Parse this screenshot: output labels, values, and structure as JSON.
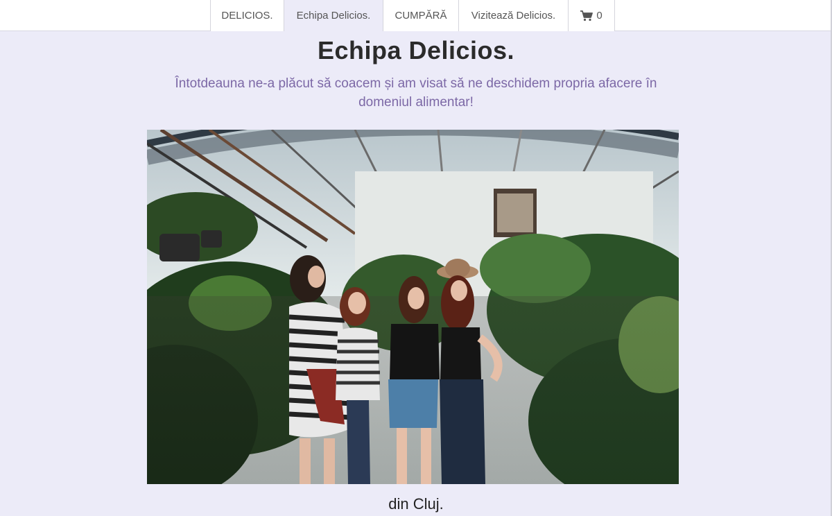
{
  "nav": {
    "items": [
      {
        "label": "DELICIOS."
      },
      {
        "label": "Echipa Delicios."
      },
      {
        "label": "CUMPĂRĂ"
      },
      {
        "label": "Vizitează Delicios."
      }
    ],
    "cart": {
      "icon": "shopping-cart-icon",
      "count": "0"
    }
  },
  "page": {
    "title": "Echipa Delicios.",
    "subtitle": "Întotdeauna ne-a plăcut să coacem și am visat să ne deschidem propria afacere în domeniul alimentar!",
    "caption": "din Cluj."
  },
  "colors": {
    "background": "#ecebf8",
    "active_tab": "#ecebf8",
    "subtitle": "#7c68a6"
  }
}
